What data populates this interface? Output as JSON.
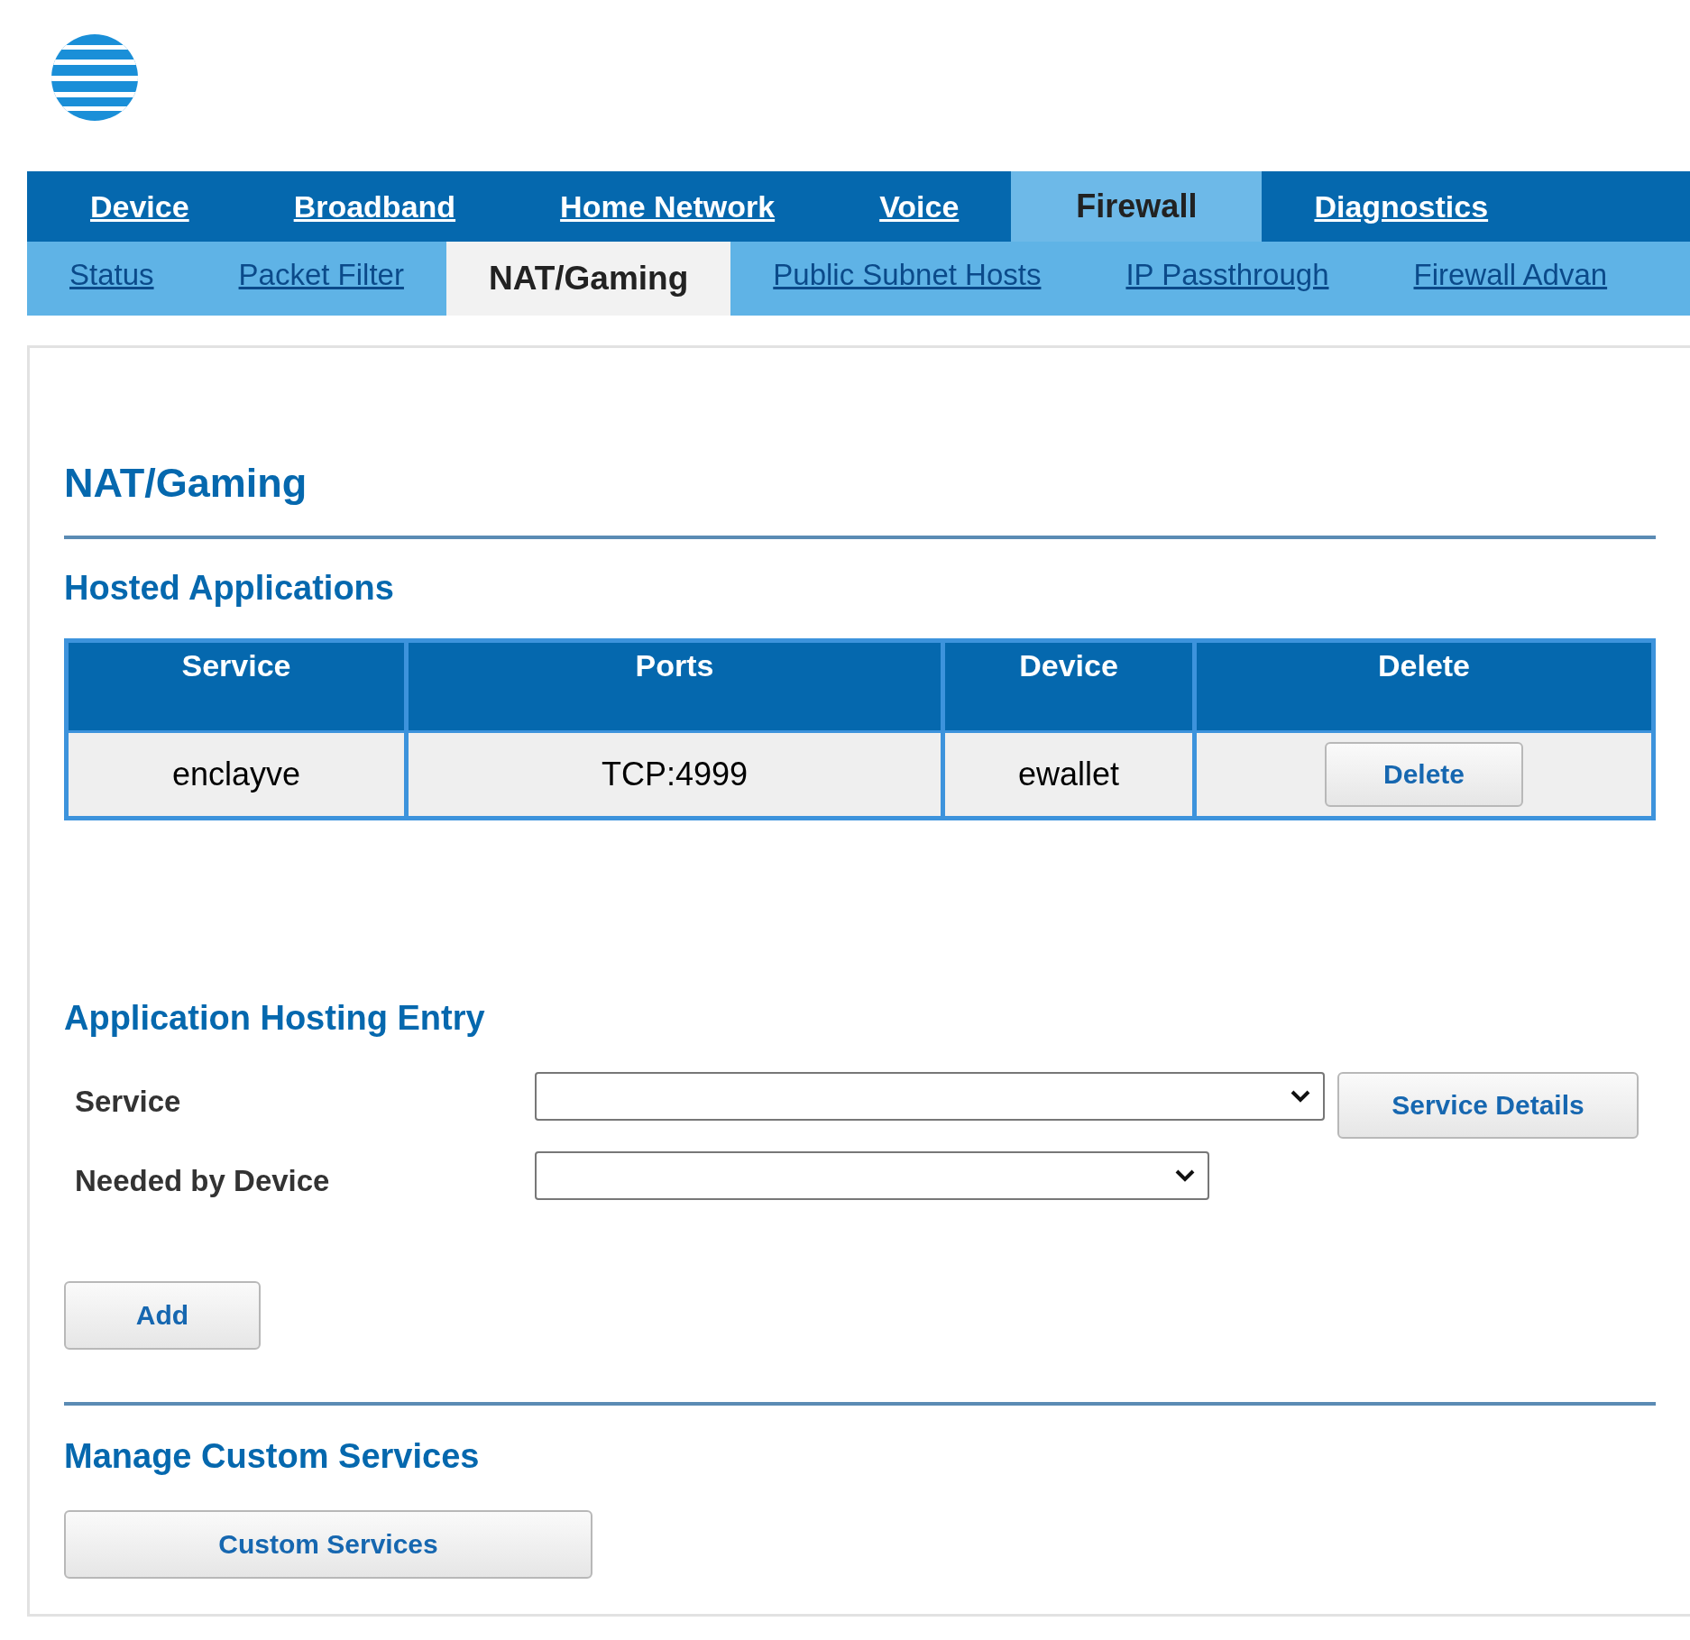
{
  "nav": {
    "tabs": [
      {
        "label": "Device",
        "selected": false
      },
      {
        "label": "Broadband",
        "selected": false
      },
      {
        "label": "Home Network",
        "selected": false
      },
      {
        "label": "Voice",
        "selected": false
      },
      {
        "label": "Firewall",
        "selected": true
      },
      {
        "label": "Diagnostics",
        "selected": false
      }
    ]
  },
  "subnav": {
    "tabs": [
      {
        "label": "Status",
        "selected": false
      },
      {
        "label": "Packet Filter",
        "selected": false
      },
      {
        "label": "NAT/Gaming",
        "selected": true
      },
      {
        "label": "Public Subnet Hosts",
        "selected": false
      },
      {
        "label": "IP Passthrough",
        "selected": false
      },
      {
        "label": "Firewall Advan",
        "selected": false
      }
    ]
  },
  "page_title": "NAT/Gaming",
  "hosted_applications": {
    "title": "Hosted Applications",
    "table": {
      "columns": [
        "Service",
        "Ports",
        "Device",
        "Delete"
      ],
      "rows": [
        {
          "service": "enclayve",
          "ports": "TCP:4999",
          "device": "ewallet",
          "action": "Delete"
        }
      ]
    }
  },
  "entry": {
    "title": "Application Hosting Entry",
    "service_label": "Service",
    "details_button": "Service Details",
    "device_label": "Needed by Device",
    "add_button": "Add"
  },
  "custom": {
    "title": "Manage Custom Services",
    "button": "Custom Services"
  }
}
